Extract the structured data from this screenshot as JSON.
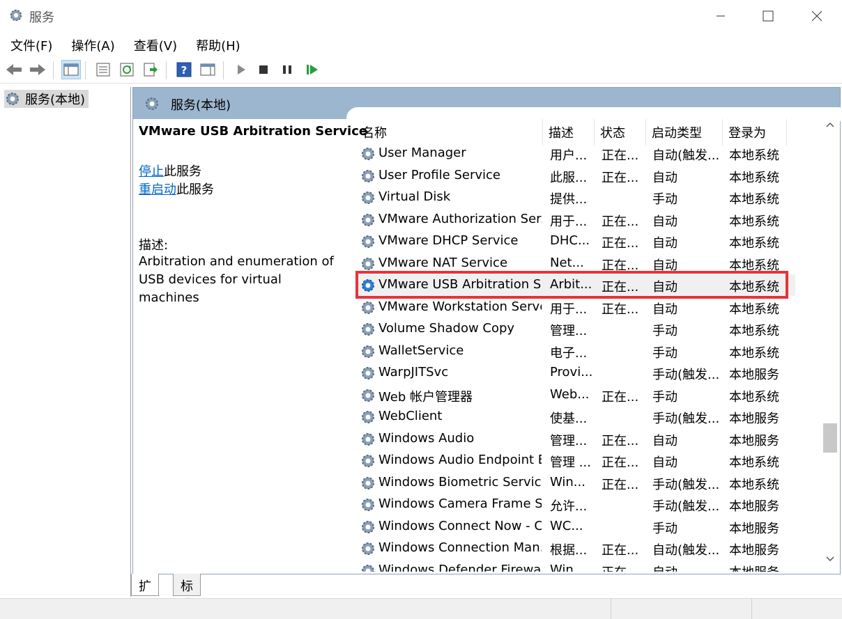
{
  "window": {
    "title": "服务"
  },
  "menu": [
    "文件(F)",
    "操作(A)",
    "查看(V)",
    "帮助(H)"
  ],
  "tree": {
    "root": "服务(本地)"
  },
  "panel": {
    "title": "服务(本地)"
  },
  "detail": {
    "service_name": "VMware USB Arbitration Service",
    "stop_link": "停止",
    "stop_suffix": "此服务",
    "restart_link": "重启动",
    "restart_suffix": "此服务",
    "desc_label": "描述:",
    "desc_text": "Arbitration and enumeration of USB devices for virtual machines"
  },
  "columns": {
    "name": "名称",
    "desc": "描述",
    "status": "状态",
    "startup": "启动类型",
    "logon": "登录为"
  },
  "services": [
    {
      "name": "User Manager",
      "desc": "用户...",
      "status": "正在...",
      "startup": "自动(触发...",
      "logon": "本地系统"
    },
    {
      "name": "User Profile Service",
      "desc": "此服...",
      "status": "正在...",
      "startup": "自动",
      "logon": "本地系统"
    },
    {
      "name": "Virtual Disk",
      "desc": "提供...",
      "status": "",
      "startup": "手动",
      "logon": "本地系统"
    },
    {
      "name": "VMware Authorization Ser...",
      "desc": "用于...",
      "status": "正在...",
      "startup": "自动",
      "logon": "本地系统"
    },
    {
      "name": "VMware DHCP Service",
      "desc": "DHC...",
      "status": "正在...",
      "startup": "自动",
      "logon": "本地系统"
    },
    {
      "name": "VMware NAT Service",
      "desc": "Net...",
      "status": "正在...",
      "startup": "自动",
      "logon": "本地系统"
    },
    {
      "name": "VMware USB Arbitration S...",
      "desc": "Arbit...",
      "status": "正在...",
      "startup": "自动",
      "logon": "本地系统"
    },
    {
      "name": "VMware Workstation Server",
      "desc": "用于...",
      "status": "正在...",
      "startup": "自动",
      "logon": "本地系统"
    },
    {
      "name": "Volume Shadow Copy",
      "desc": "管理...",
      "status": "",
      "startup": "手动",
      "logon": "本地系统"
    },
    {
      "name": "WalletService",
      "desc": "电子...",
      "status": "",
      "startup": "手动",
      "logon": "本地系统"
    },
    {
      "name": "WarpJITSvc",
      "desc": "Provi...",
      "status": "",
      "startup": "手动(触发...",
      "logon": "本地服务"
    },
    {
      "name": "Web 帐户管理器",
      "desc": "Web...",
      "status": "正在...",
      "startup": "手动",
      "logon": "本地系统"
    },
    {
      "name": "WebClient",
      "desc": "使基...",
      "status": "",
      "startup": "手动(触发...",
      "logon": "本地服务"
    },
    {
      "name": "Windows Audio",
      "desc": "管理...",
      "status": "正在...",
      "startup": "自动",
      "logon": "本地服务"
    },
    {
      "name": "Windows Audio Endpoint B...",
      "desc": "管理 ...",
      "status": "正在...",
      "startup": "自动",
      "logon": "本地系统"
    },
    {
      "name": "Windows Biometric Service",
      "desc": "Win...",
      "status": "正在...",
      "startup": "手动(触发...",
      "logon": "本地系统"
    },
    {
      "name": "Windows Camera Frame S...",
      "desc": "允许...",
      "status": "",
      "startup": "手动(触发...",
      "logon": "本地服务"
    },
    {
      "name": "Windows Connect Now - C...",
      "desc": "WC...",
      "status": "",
      "startup": "手动",
      "logon": "本地服务"
    },
    {
      "name": "Windows Connection Man...",
      "desc": "根据...",
      "status": "正在...",
      "startup": "自动(触发...",
      "logon": "本地服务"
    },
    {
      "name": "Windows Defender Firewall",
      "desc": "Win...",
      "status": "正在...",
      "startup": "自动",
      "logon": "本地服务"
    }
  ],
  "selected_service": "VMware USB Arbitration S...",
  "tabs": [
    "扩展",
    "标准"
  ],
  "colors": {
    "header": "#9db6cf",
    "highlight": "#e8323a",
    "link": "#0066cc"
  }
}
